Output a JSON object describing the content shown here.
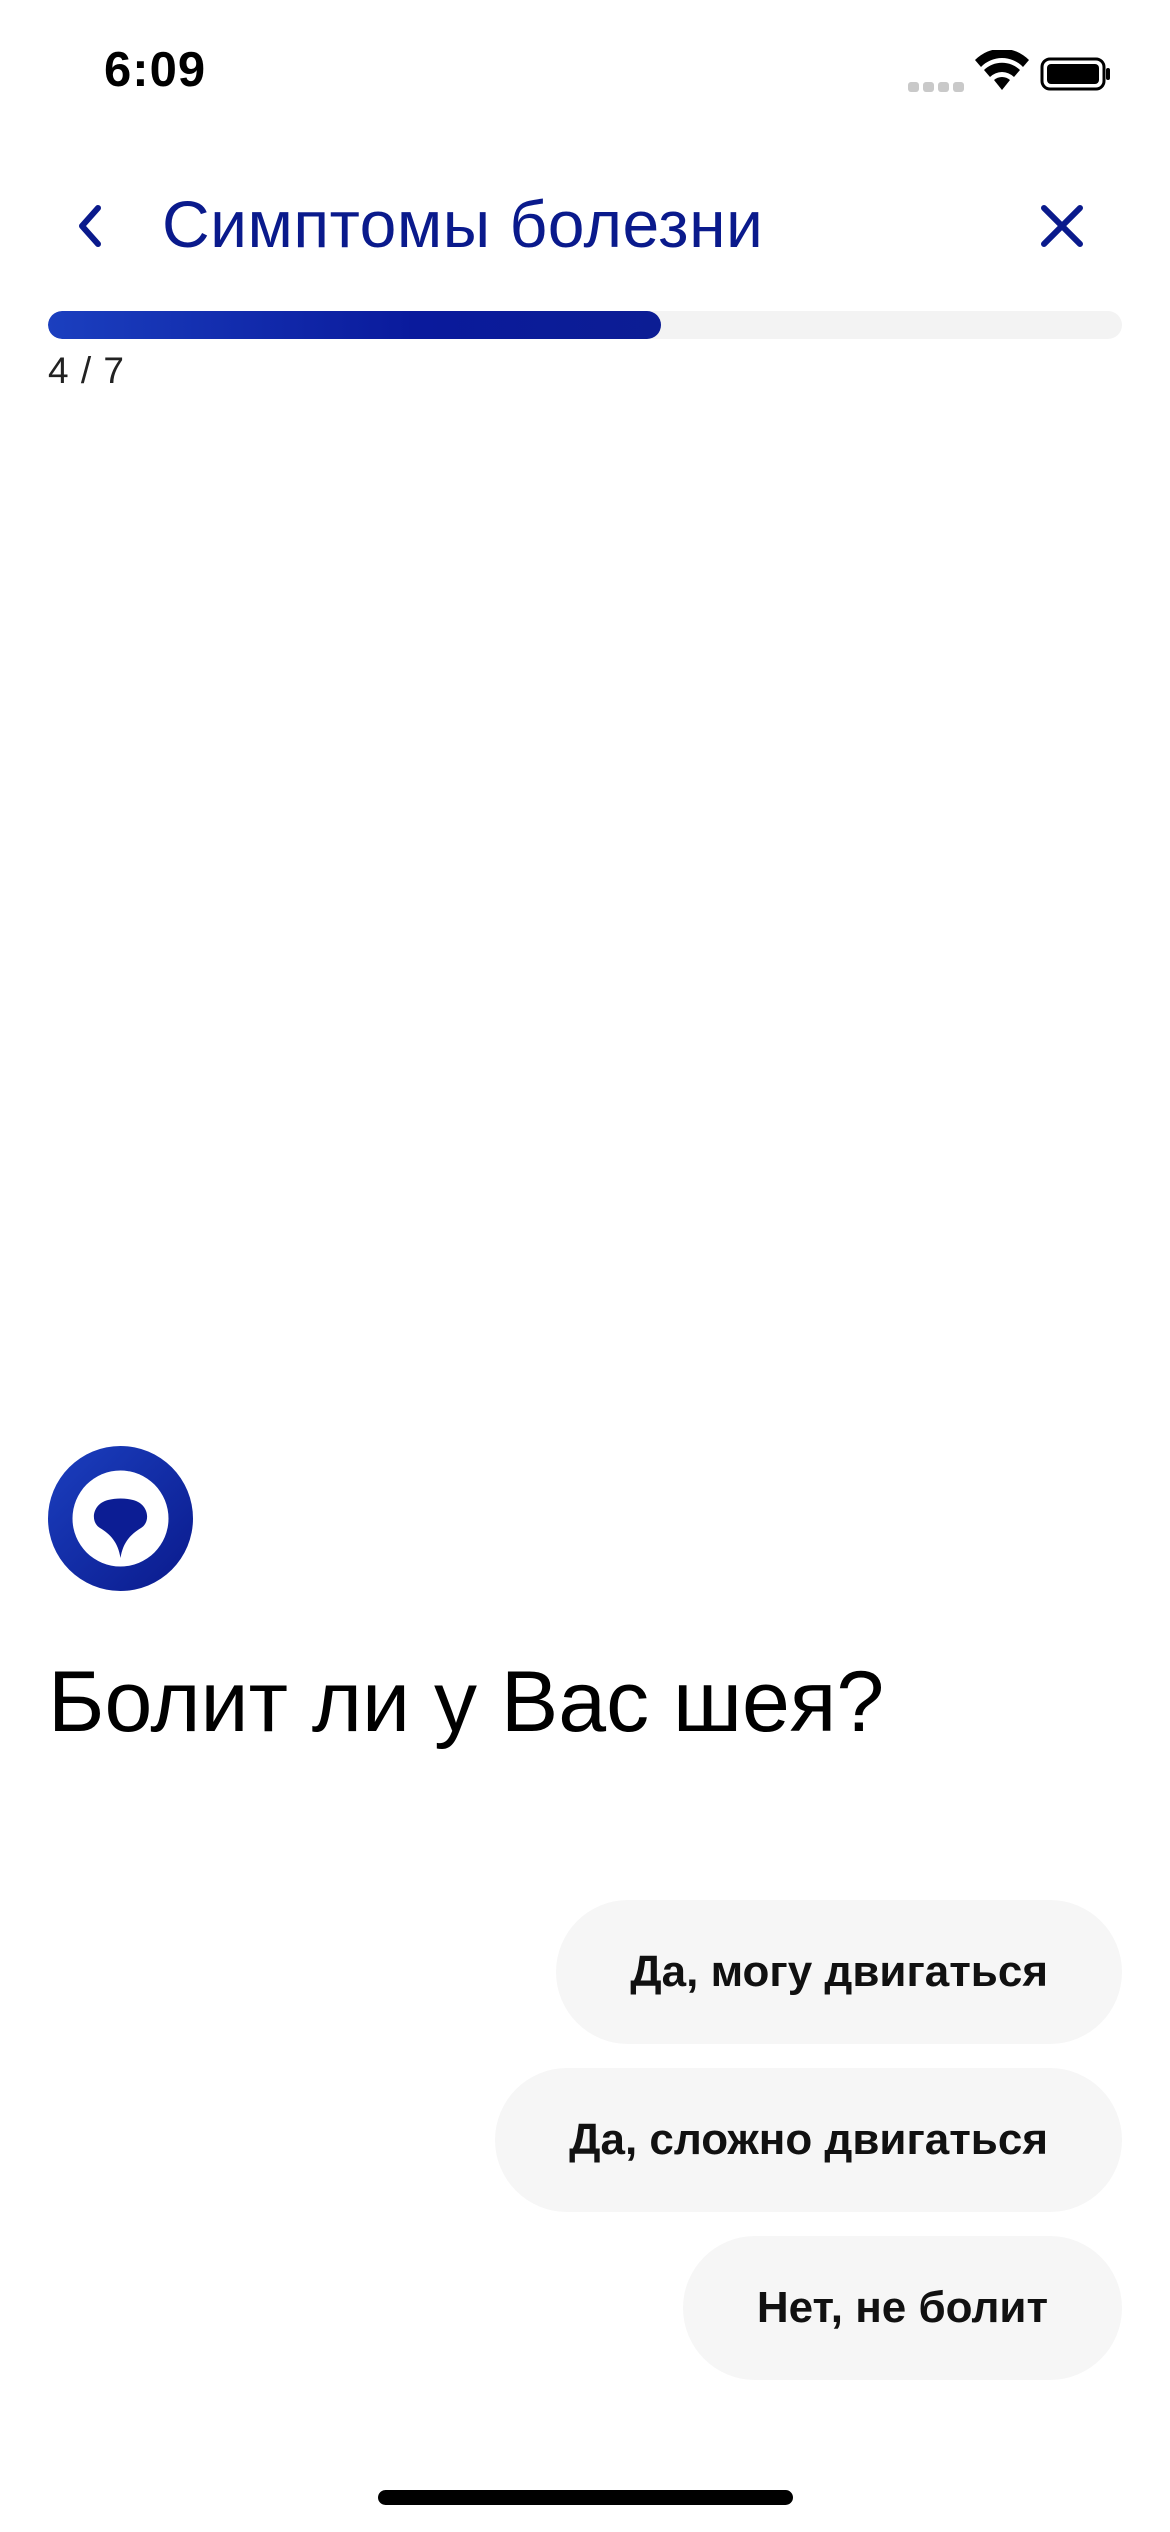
{
  "status_bar": {
    "time": "6:09",
    "icons": [
      "cellular-signal-icon",
      "wifi-icon",
      "battery-icon"
    ]
  },
  "header": {
    "title": "Симптомы болезни",
    "back_icon": "chevron-left-icon",
    "close_icon": "close-icon"
  },
  "progress": {
    "label": "4 / 7",
    "current": 4,
    "total": 7,
    "fraction": 0.571
  },
  "chat": {
    "avatar_icon": "bot-avatar-icon",
    "question": "Болит ли у Вас шея?"
  },
  "answers": [
    {
      "label": "Да, могу двигаться"
    },
    {
      "label": "Да, сложно двигаться"
    },
    {
      "label": "Нет, не болит"
    }
  ],
  "colors": {
    "accent": "#0a1a8c",
    "progress_fill": "#0a1a9c",
    "progress_track": "#f3f3f3",
    "answer_background": "#f6f6f6",
    "text": "#000000"
  }
}
